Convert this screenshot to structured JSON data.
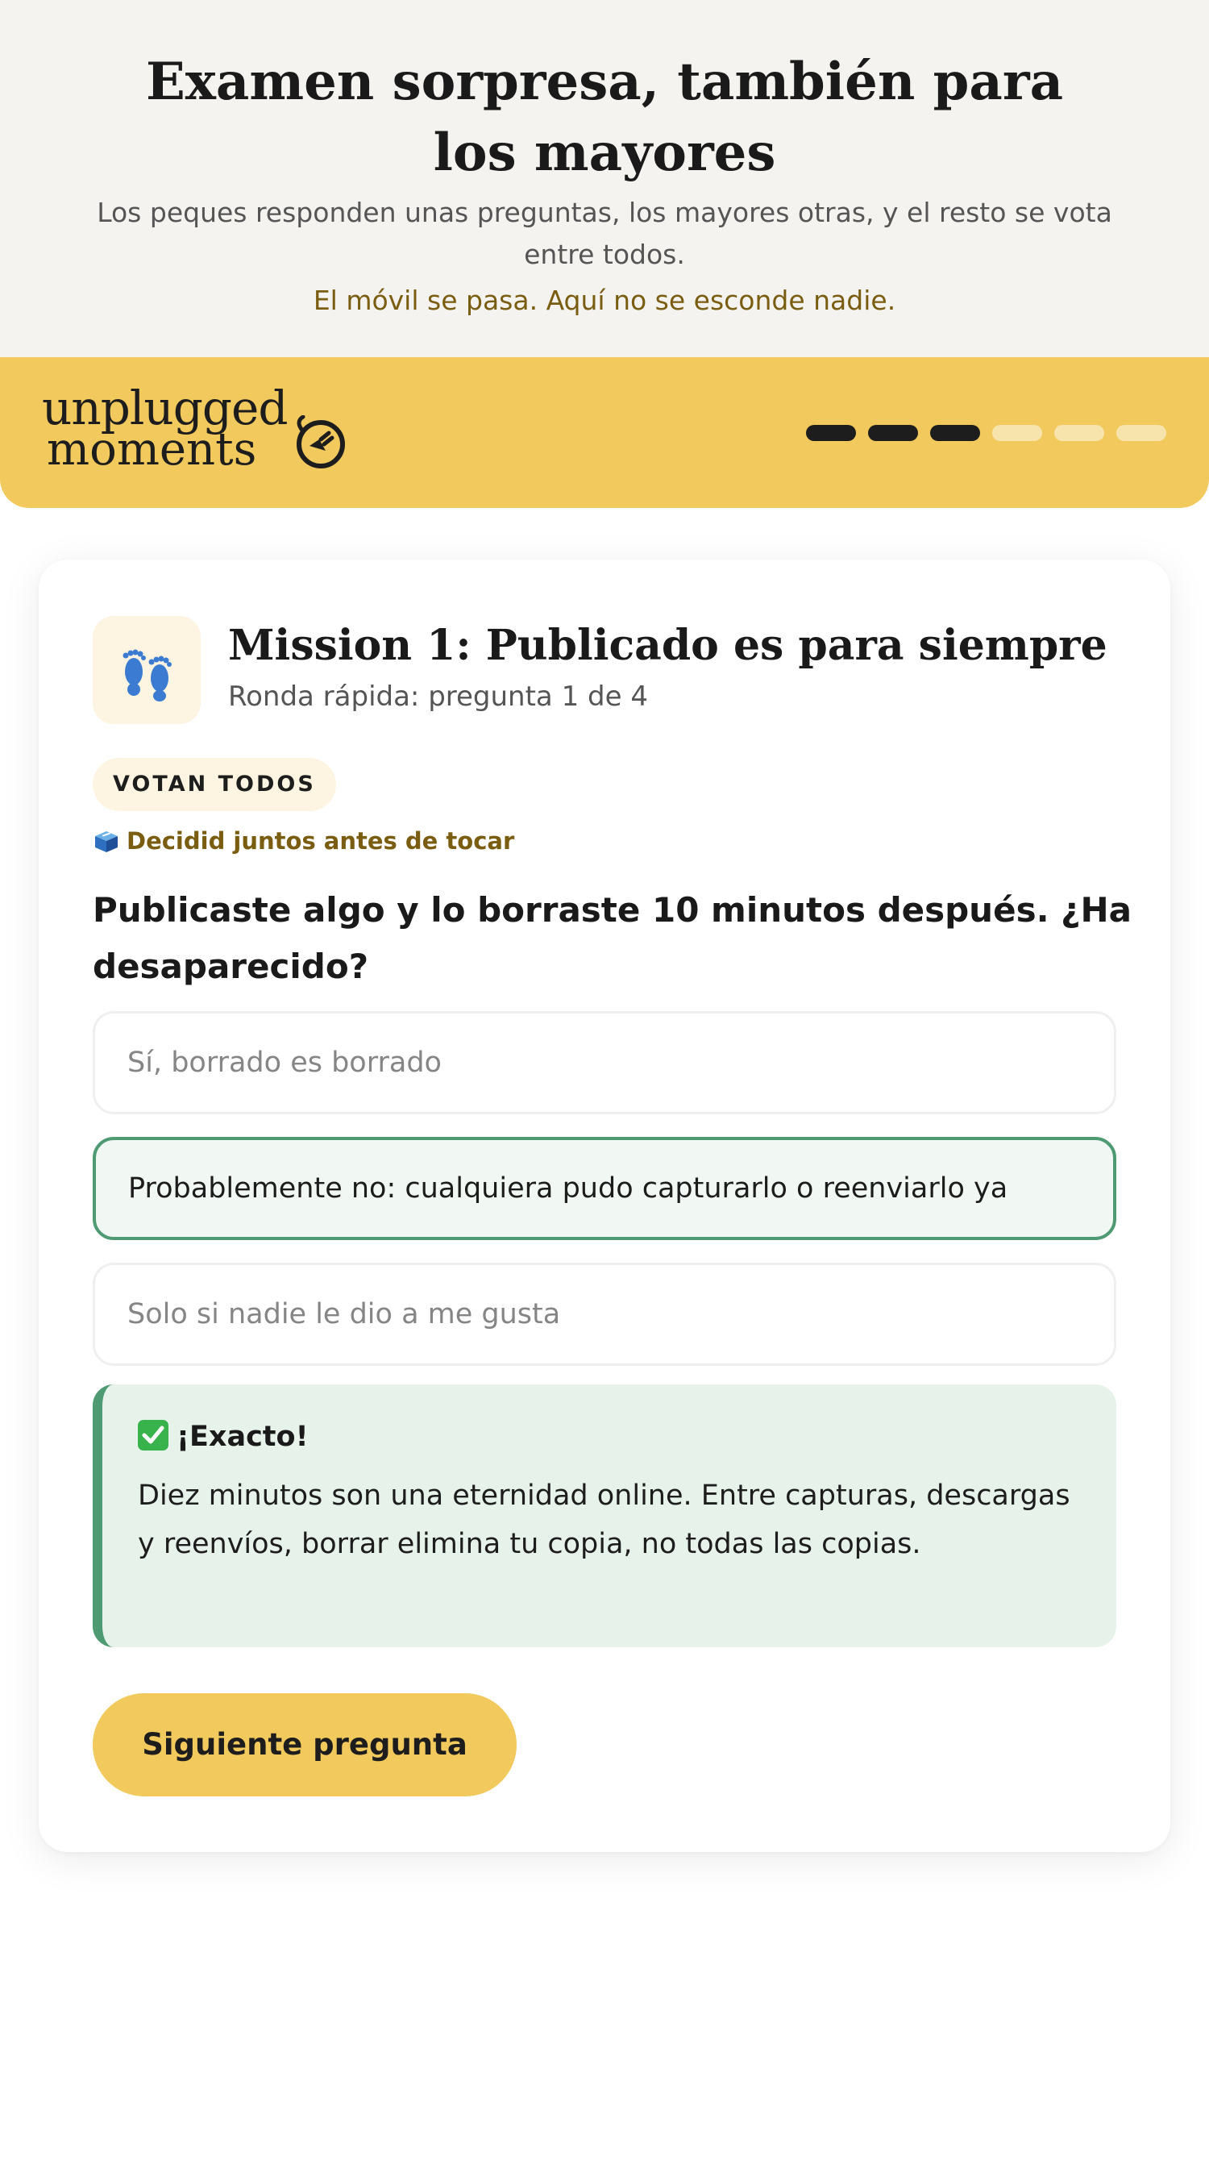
{
  "hero": {
    "title": "Examen sorpresa, también para los mayores",
    "subtitle": "Los peques responden unas preguntas, los mayores otras, y el resto se vota entre todos.",
    "note": "El móvil se pasa. Aquí no se esconde nadie."
  },
  "brand": {
    "logo_line1": "unplugged",
    "logo_line2": "moments",
    "progress": {
      "total_steps": 6,
      "completed_steps": 3
    },
    "colors": {
      "bar": "#f2c95c",
      "segment_done": "#1d1d1d",
      "segment_todo": "#f7e3ac"
    }
  },
  "mission": {
    "icon": "footprints-icon",
    "title": "Mission 1: Publicado es para siempre",
    "subtitle": "Ronda rápida: pregunta 1 de 4",
    "badge": "VOTAN TODOS",
    "hint_icon": "ballot-box-icon",
    "hint": "Decidid juntos antes de tocar",
    "question": "Publicaste algo y lo borraste 10 minutos después. ¿Ha desaparecido?"
  },
  "options": [
    {
      "label": "Sí, borrado es borrado",
      "state": "unselected"
    },
    {
      "label": "Probablemente no: cualquiera pudo capturarlo o reenviarlo ya",
      "state": "correct"
    },
    {
      "label": "Solo si nadie le dio a me gusta",
      "state": "unselected"
    }
  ],
  "feedback": {
    "icon": "check-mark-icon",
    "title": "¡Exacto!",
    "body": "Diez minutos son una eternidad online. Entre capturas, descargas y reenvíos, borrar elimina tu copia, no todas las copias.",
    "accent": "#4e9a73"
  },
  "actions": {
    "next_label": "Siguiente pregunta"
  }
}
